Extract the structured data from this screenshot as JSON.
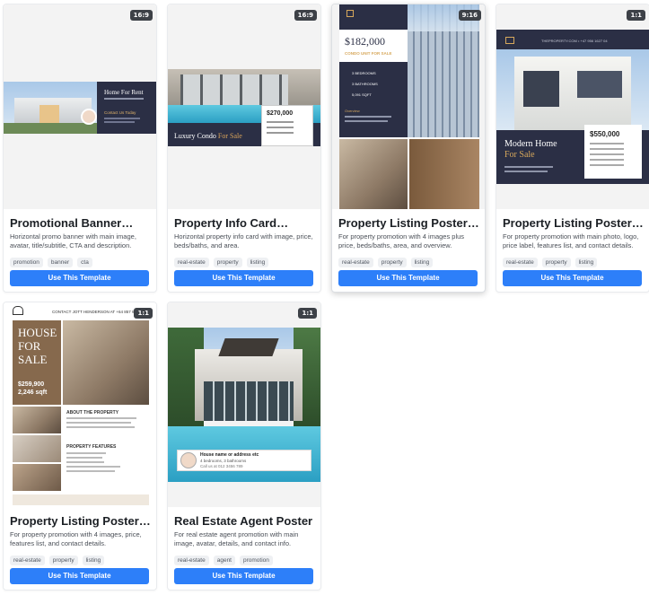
{
  "button_label": "Use This Template",
  "cards": [
    {
      "ratio": "16:9",
      "title": "Promotional Banner…",
      "desc": "Horizontal promo banner with main image, avatar, title/subtitle, CTA and description.",
      "tags": [
        "promotion",
        "banner",
        "cta"
      ],
      "preview": {
        "heading": "Home For Rent",
        "cta": "Contact Us Today"
      }
    },
    {
      "ratio": "16:9",
      "title": "Property Info Card…",
      "desc": "Horizontal property info card with image, price, beds/baths, and area.",
      "tags": [
        "real-estate",
        "property",
        "listing"
      ],
      "preview": {
        "heading_a": "Luxury Condo",
        "heading_b": "For Sale",
        "price": "$270,000"
      }
    },
    {
      "ratio": "9:16",
      "title": "Property Listing Poster (…",
      "desc": "For property promotion with 4 images plus price, beds/baths, area, and overview.",
      "tags": [
        "real-estate",
        "property",
        "listing"
      ],
      "preview": {
        "price": "$182,000",
        "subtitle": "CONDO UNIT FOR SALE",
        "beds": "3 BEDROOMS",
        "baths": "3 BATHROOMS",
        "area": "5,091 SQFT",
        "overview": "Overview"
      }
    },
    {
      "ratio": "1:1",
      "title": "Property Listing Poster…",
      "desc": "For property promotion with main photo, logo, price label, features list, and contact details.",
      "tags": [
        "real-estate",
        "property",
        "listing"
      ],
      "preview": {
        "topline": "THEPROPERTY.COM • +47 956 1627 04",
        "heading_a": "Modern Home",
        "heading_b": "For Sale",
        "price": "$550,000"
      }
    },
    {
      "ratio": "1:1",
      "title": "Property Listing Poster (…",
      "desc": "For property promotion with 4 images, price, features list, and contact details.",
      "tags": [
        "real-estate",
        "property",
        "listing"
      ],
      "preview": {
        "topline": "CONTACT JOTT HENDERSON AT +64 857 94",
        "heading": [
          "HOUSE",
          "FOR",
          "SALE"
        ],
        "price": "$259,900",
        "area": "2,246 sqft",
        "about": "ABOUT THE PROPERTY",
        "features": "PROPERTY FEATURES"
      }
    },
    {
      "ratio": "1:1",
      "title": "Real Estate Agent Poster",
      "desc": "For real estate agent promotion with main image, avatar, details, and contact info.",
      "tags": [
        "real-estate",
        "agent",
        "promotion"
      ],
      "preview": {
        "line1": "House name or address etc",
        "line2": "4 bedrooms, 3 bathrooms",
        "line3": "Call us at 012 3456 789"
      }
    }
  ]
}
